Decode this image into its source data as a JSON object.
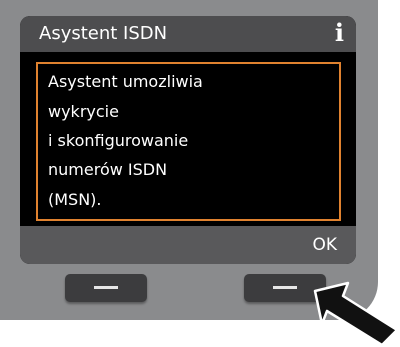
{
  "screen": {
    "title": "Asystent ISDN",
    "info_icon": "info-icon",
    "message_lines": [
      "Asystent umozliwia",
      "wykrycie",
      "i skonfigurowanie",
      "numerów ISDN",
      "(MSN)."
    ],
    "softkey_right_label": "OK"
  },
  "colors": {
    "device_body": "#8a8b8d",
    "screen_background": "#000000",
    "title_bar": "#4d4d4f",
    "highlight_border": "#e0822f",
    "softkey_bar": "#59595b",
    "hardware_key": "#3c3c3e"
  },
  "icons": {
    "arrow": "arrow-pointer-icon"
  }
}
